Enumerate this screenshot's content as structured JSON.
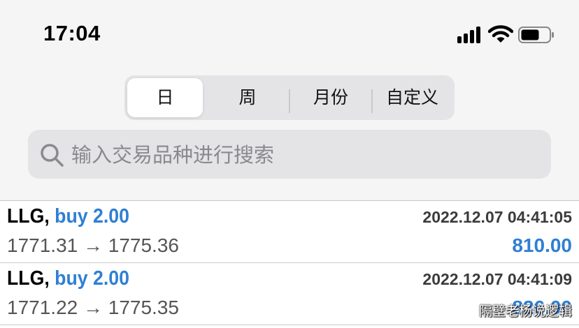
{
  "status_bar": {
    "time": "17:04"
  },
  "tabs": [
    {
      "label": "日",
      "active": true
    },
    {
      "label": "周",
      "active": false
    },
    {
      "label": "月份",
      "active": false
    },
    {
      "label": "自定义",
      "active": false
    }
  ],
  "search": {
    "placeholder": "输入交易品种进行搜索",
    "value": ""
  },
  "trades": [
    {
      "symbol": "LLG,",
      "trade": "buy 2.00",
      "timestamp": "2022.12.07 04:41:05",
      "prices": "1771.31 → 1775.36",
      "profit": "810.00"
    },
    {
      "symbol": "LLG,",
      "trade": "buy 2.00",
      "timestamp": "2022.12.07 04:41:09",
      "prices": "1771.22 → 1775.35",
      "profit": "826.00"
    }
  ],
  "watermark": "隔壁老杨说逻辑",
  "colors": {
    "accent": "#2f7fd4",
    "header_bg": "#f5f5f5",
    "control_bg": "#e4e4e6"
  }
}
